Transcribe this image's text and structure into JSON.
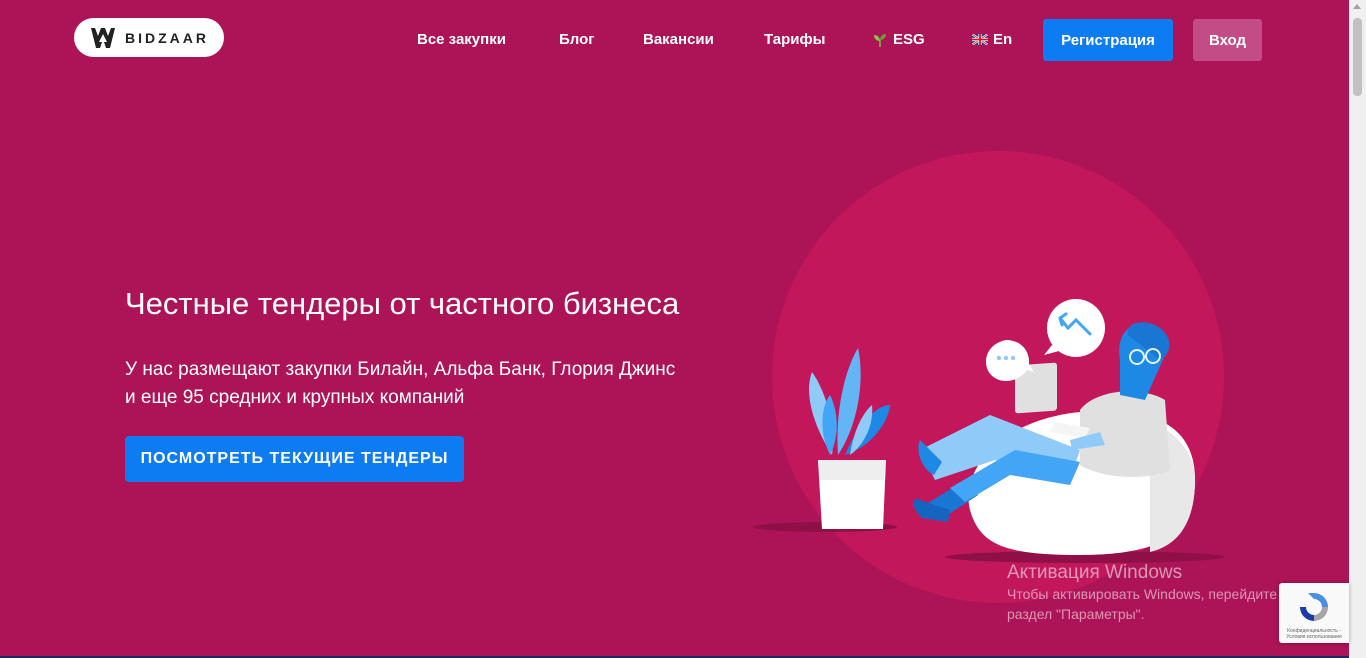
{
  "header": {
    "logo_text": "BIDZAAR",
    "nav": {
      "all_purchases": "Все закупки",
      "blog": "Блог",
      "vacancies": "Вакансии",
      "tariffs": "Тарифы",
      "esg": "ESG",
      "language": "En"
    },
    "register_label": "Регистрация",
    "login_label": "Вход"
  },
  "hero": {
    "title": "Честные тендеры от частного бизнеса",
    "subtitle_line1": "У нас размещают закупки Билайн, Альфа Банк, Глория Джинс",
    "subtitle_line2": "и еще 95 средних и крупных компаний",
    "cta_label": "ПОСМОТРЕТЬ ТЕКУЩИЕ ТЕНДЕРЫ"
  },
  "overlay": {
    "activation_title": "Активация Windows",
    "activation_line1": "Чтобы активировать Windows, перейдите в",
    "activation_line2": "раздел \"Параметры\".",
    "recaptcha_text": "Конфиденциальность - Условия использования"
  },
  "icons": {
    "esg": "sprout-icon",
    "language": "uk-flag-icon",
    "logo": "bidzaar-logo-icon"
  },
  "colors": {
    "background": "#ad1457",
    "accent_blue": "#0d7cf2",
    "circle": "#c2185b",
    "login_button": "#c24d86"
  }
}
